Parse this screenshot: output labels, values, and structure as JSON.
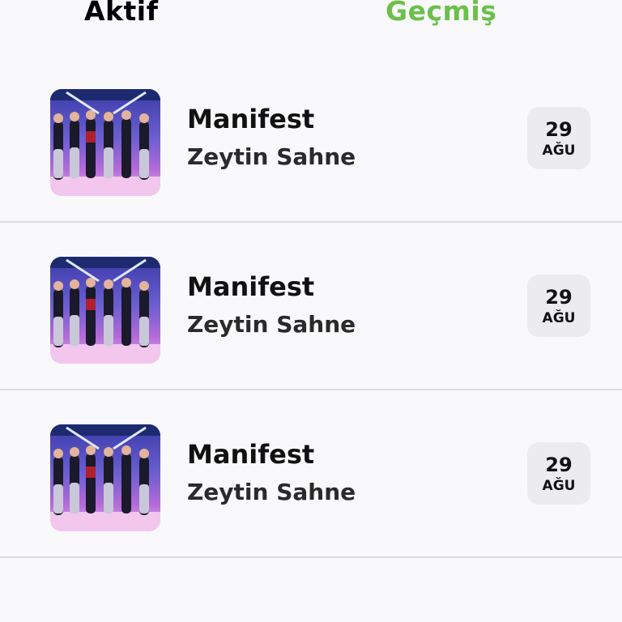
{
  "tabs": {
    "active_label": "Aktif",
    "past_label": "Geçmiş",
    "selected_color": "#6cc04a"
  },
  "events": [
    {
      "title": "Manifest",
      "venue": "Zeytin Sahne",
      "day": "29",
      "month": "AĞU"
    },
    {
      "title": "Manifest",
      "venue": "Zeytin Sahne",
      "day": "29",
      "month": "AĞU"
    },
    {
      "title": "Manifest",
      "venue": "Zeytin Sahne",
      "day": "29",
      "month": "AĞU"
    }
  ]
}
